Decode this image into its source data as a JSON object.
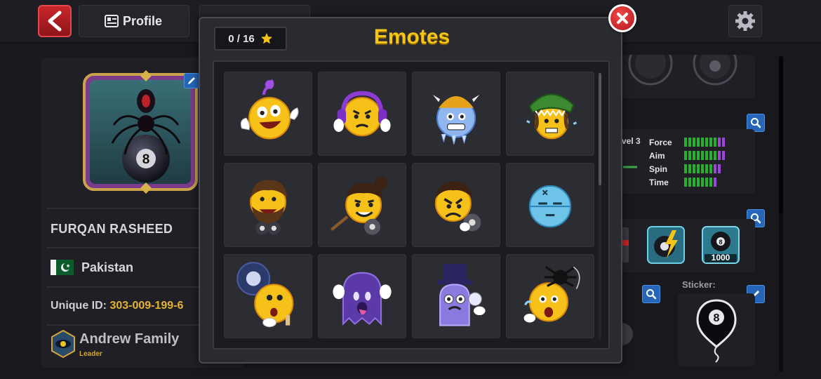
{
  "topbar": {
    "back_icon": "chevron-left-icon",
    "profile_tab_label": "Profile",
    "profile_tab_icon": "profile-card-icon",
    "settings_icon": "gear-icon"
  },
  "profile": {
    "name": "FURQAN RASHEED",
    "country": "Pakistan",
    "unique_id_label": "Unique ID:",
    "unique_id_value": "303-009-199-6",
    "club_name": "Andrew Family",
    "club_role": "Leader"
  },
  "stats": {
    "level_text": "vel 3",
    "rows": [
      {
        "label": "Force",
        "green": 8,
        "purple": 2
      },
      {
        "label": "Aim",
        "green": 8,
        "purple": 2
      },
      {
        "label": "Spin",
        "green": 7,
        "purple": 2
      },
      {
        "label": "Time",
        "green": 7,
        "purple": 1
      }
    ],
    "sticker_label": "Sticker:",
    "badge_1000": "1000"
  },
  "modal": {
    "title": "Emotes",
    "counter": "0 / 16",
    "counter_icon": "star-icon",
    "close_icon": "close-icon",
    "emotes": [
      "dizzy-laughing-emote",
      "headphones-annoyed-emote",
      "frozen-viking-emote",
      "dino-hat-scared-emote",
      "bearded-laughing-emote",
      "bun-hair-mischief-emote",
      "angry-eight-ball-emote",
      "sleepy-blue-emote",
      "eight-ball-thought-emote",
      "purple-ghost-emote",
      "top-hat-ghost-emote",
      "spider-scared-emote"
    ]
  },
  "colors": {
    "accent_gold": "#f6c417",
    "uid_gold": "#e3b433",
    "close_red": "#d3262b",
    "stat_green": "#25b02d",
    "stat_purple": "#9b47d8"
  }
}
